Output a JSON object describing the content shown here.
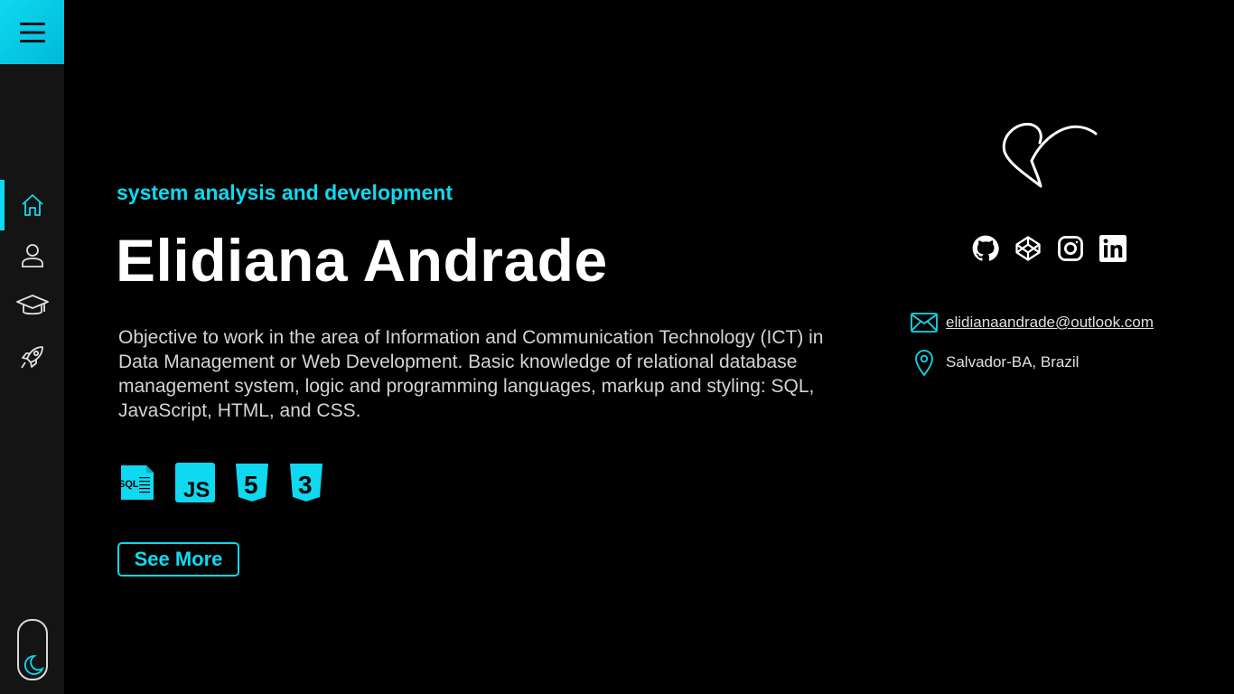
{
  "sidebar": {
    "menu_icon": "hamburger-icon",
    "items": [
      {
        "icon": "home-icon",
        "active": true
      },
      {
        "icon": "user-icon",
        "active": false
      },
      {
        "icon": "graduation-cap-icon",
        "active": false
      },
      {
        "icon": "rocket-icon",
        "active": false
      }
    ],
    "theme_icon": "moon-icon"
  },
  "hero": {
    "subtitle": "system analysis and development",
    "name": "Elidiana Andrade",
    "description": "Objective to work in the area of Information and Communication Technology (ICT) in Data Management or Web Development. Basic knowledge of  relational database management system, logic and programming languages, markup and styling: SQL, JavaScript, HTML, and CSS.",
    "skills": [
      {
        "icon": "sql-icon",
        "label": "SQL"
      },
      {
        "icon": "javascript-icon",
        "label": "JS"
      },
      {
        "icon": "html5-icon",
        "label": "5"
      },
      {
        "icon": "css3-icon",
        "label": "3"
      }
    ],
    "see_more_label": "See More"
  },
  "profile": {
    "logo_icon": "signature-logo-icon",
    "socials": [
      {
        "icon": "github-icon"
      },
      {
        "icon": "codepen-icon"
      },
      {
        "icon": "instagram-icon"
      },
      {
        "icon": "linkedin-icon"
      }
    ],
    "email": "elidianaandrade@outlook.com",
    "location": "Salvador-BA, Brazil"
  },
  "colors": {
    "accent": "#0fd9f0",
    "background": "#000000",
    "sidebar": "#141414"
  }
}
